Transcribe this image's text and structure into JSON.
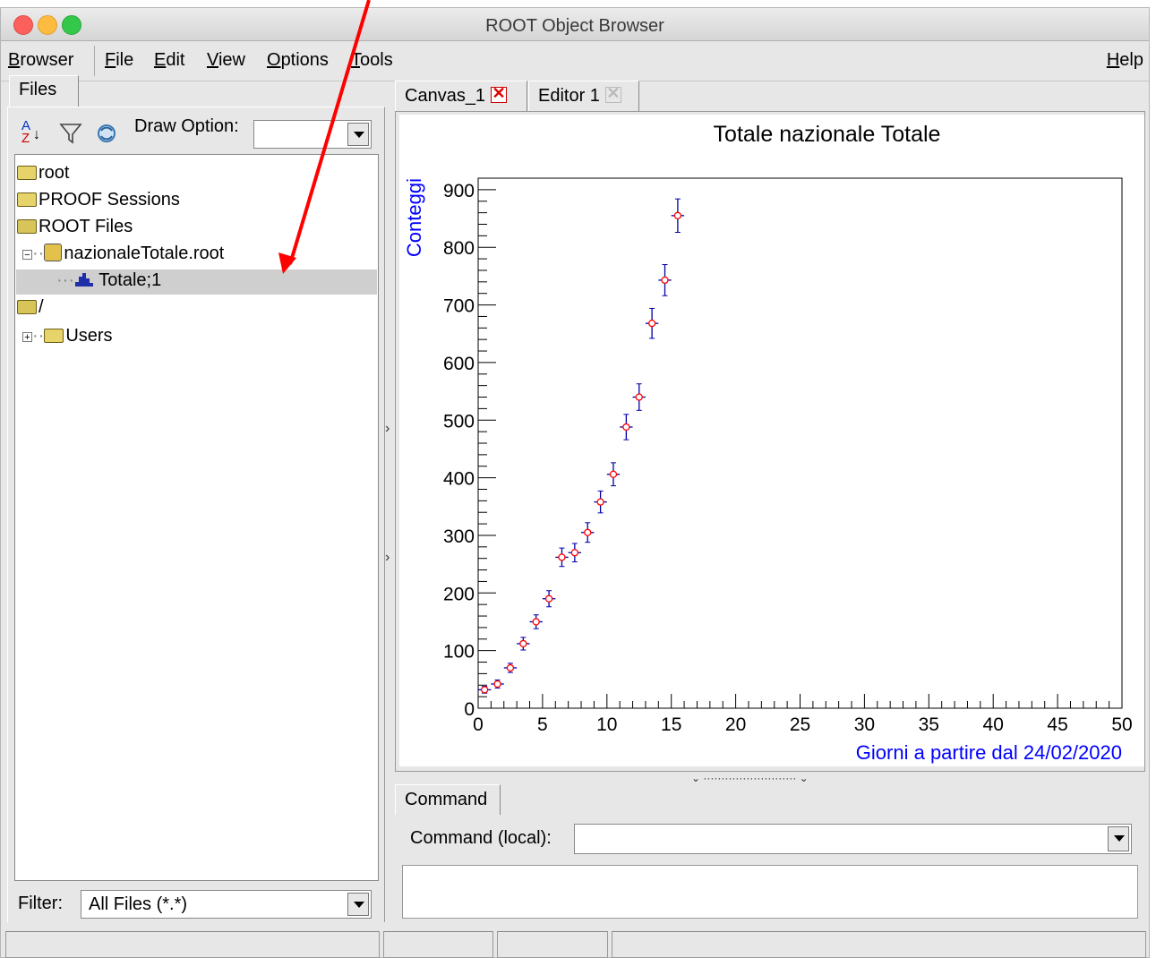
{
  "window": {
    "title": "ROOT Object Browser"
  },
  "menubar": {
    "items": [
      {
        "pre": "",
        "u": "B",
        "post": "rowser"
      },
      {
        "pre": "",
        "u": "F",
        "post": "ile"
      },
      {
        "pre": "",
        "u": "E",
        "post": "dit"
      },
      {
        "pre": "",
        "u": "V",
        "post": "iew"
      },
      {
        "pre": "",
        "u": "O",
        "post": "ptions"
      },
      {
        "pre": "",
        "u": "T",
        "post": "ools"
      }
    ],
    "help": {
      "u": "H",
      "post": "elp"
    }
  },
  "left": {
    "tab": "Files",
    "draw_option_label": "Draw Option:",
    "draw_option_value": "",
    "tree": {
      "root": "root",
      "proof": "PROOF Sessions",
      "rootfiles": "ROOT Files",
      "file": "nazionaleTotale.root",
      "hist": "Totale;1",
      "slash": "/",
      "users": "Users"
    },
    "filter_label": "Filter:",
    "filter_value": "All Files (*.*)"
  },
  "right": {
    "tabs": [
      "Canvas_1",
      "Editor 1"
    ],
    "command_tab": "Command",
    "command_label": "Command (local):",
    "command_value": ""
  },
  "colors": {
    "axis_label": "#0000ff",
    "marker": "#ff0000",
    "errorbar": "#0000aa",
    "annotation_arrow": "#ff0000"
  },
  "chart_data": {
    "type": "scatter",
    "title": "Totale nazionale Totale",
    "xlabel": "Giorni a partire dal 24/02/2020",
    "ylabel": "Conteggi",
    "xlim": [
      0,
      50
    ],
    "ylim": [
      0,
      920
    ],
    "xticks": [
      0,
      5,
      10,
      15,
      20,
      25,
      30,
      35,
      40,
      45,
      50
    ],
    "yticks": [
      0,
      100,
      200,
      300,
      400,
      500,
      600,
      700,
      800,
      900
    ],
    "x": [
      0.5,
      1.5,
      2.5,
      3.5,
      4.5,
      5.5,
      6.5,
      7.5,
      8.5,
      9.5,
      10.5,
      11.5,
      12.5,
      13.5,
      14.5,
      15.5
    ],
    "y": [
      32,
      42,
      70,
      112,
      150,
      190,
      262,
      270,
      305,
      358,
      406,
      488,
      540,
      668,
      743,
      855
    ],
    "yerr": [
      6,
      7,
      8,
      11,
      12,
      14,
      16,
      16,
      17,
      19,
      20,
      22,
      23,
      26,
      27,
      29
    ],
    "xerr": 0.5,
    "grid": false,
    "legend": "none"
  }
}
